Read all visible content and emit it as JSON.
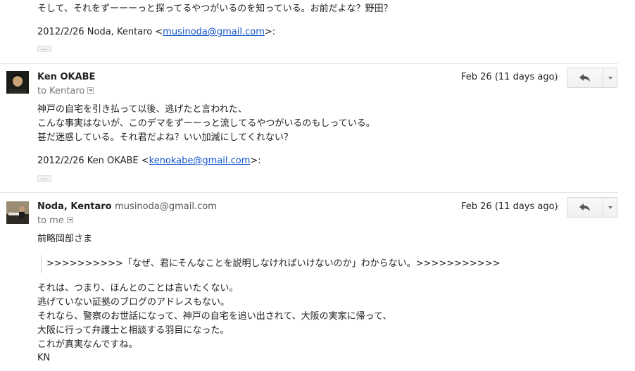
{
  "top_fragment": {
    "line": "そして、それをずーーーっと探ってるやつがいるのを知っている。お前だよな？野田？",
    "attribution_prefix": "2012/2/26 Noda, Kentaro <",
    "attribution_email": "musinoda@gmail.com",
    "attribution_suffix": ">:",
    "ellipsis": "..."
  },
  "messages": [
    {
      "sender": "Ken OKABE",
      "sender_email": "",
      "to": "to Kentaro",
      "date": "Feb 26 (11 days ago)",
      "body": [
        "神戸の自宅を引き払って以後、逃げたと言われた、",
        "こんな事実はないが、このデマをずーーっと流してるやつがいるのもしっている。",
        "甚だ迷惑している。それ君だよね？いい加減にしてくれない？"
      ],
      "attribution_prefix": "2012/2/26 Ken OKABE <",
      "attribution_email": "kenokabe@gmail.com",
      "attribution_suffix": ">:",
      "ellipsis": "..."
    },
    {
      "sender": "Noda, Kentaro",
      "sender_email": "musinoda@gmail.com",
      "to": "to me",
      "date": "Feb 26 (11 days ago)",
      "greeting": "前略岡部さま",
      "quote": ">>>>>>>>>>「なぜ、君にそんなことを説明しなければいけないのか」わからない。>>>>>>>>>>>",
      "body": [
        "それは、つまり、ほんとのことは言いたくない。",
        "逃げていない証拠のブログのアドレスもない。",
        "それなら、警察のお世話になって、神戸の自宅を追い出されて、大阪の実家に帰って、",
        "大阪に行って弁護士と相談する羽目になった。",
        "これが真実なんですね。",
        "KN"
      ]
    }
  ]
}
